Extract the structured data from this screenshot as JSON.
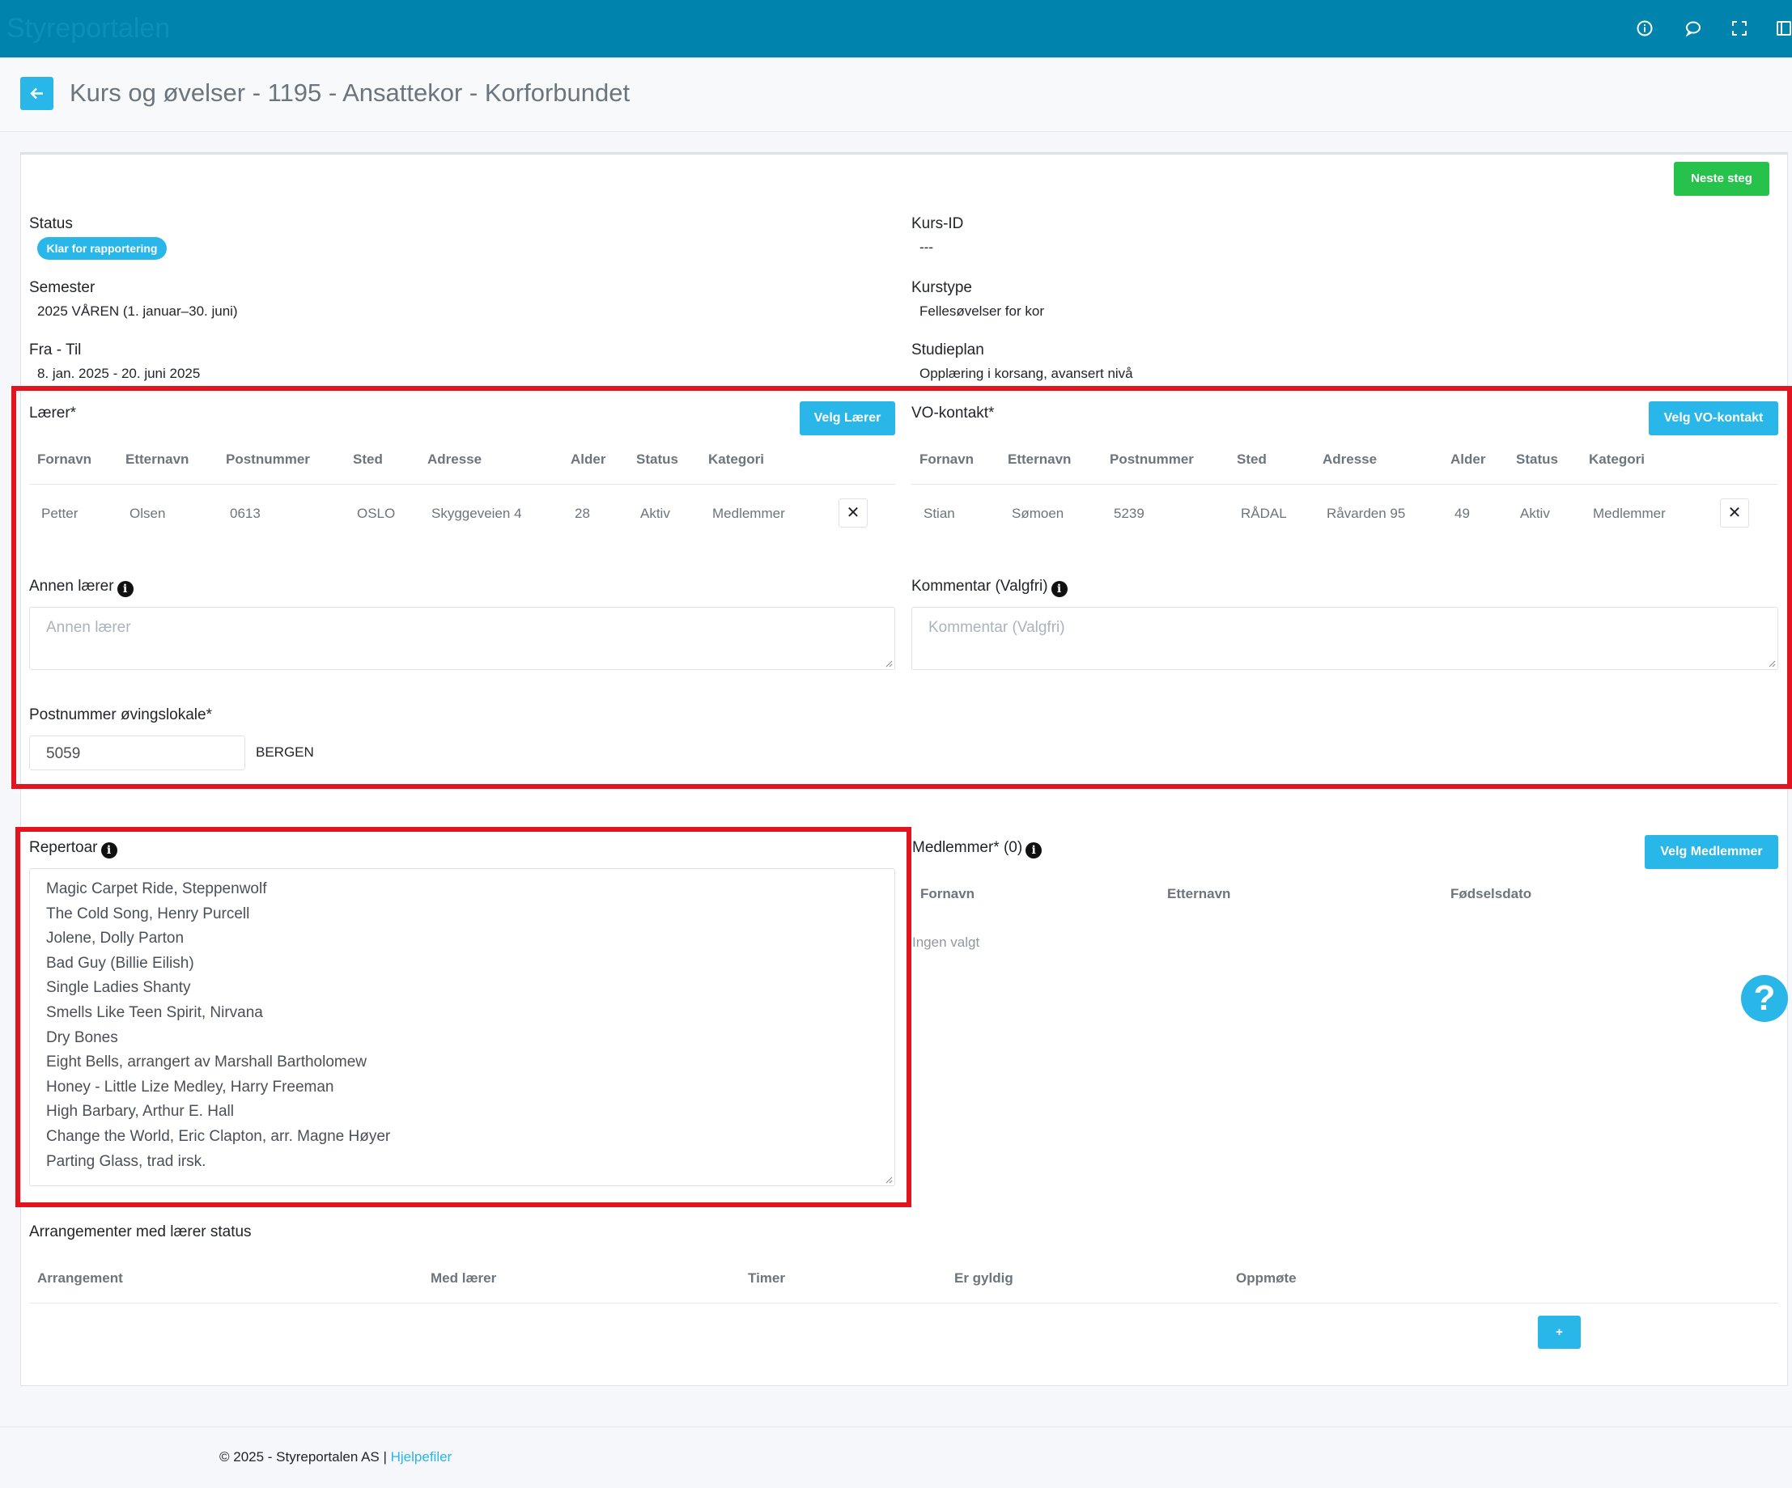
{
  "topbar": {
    "brand": "Styreportalen"
  },
  "header": {
    "title": "Kurs og øvelser - 1195 - Ansattekor - Korforbundet"
  },
  "actions": {
    "next_step": "Neste steg"
  },
  "info": {
    "status_label": "Status",
    "status_value": "Klar for rapportering",
    "kurs_id_label": "Kurs-ID",
    "kurs_id_value": "---",
    "semester_label": "Semester",
    "semester_value": "2025 VÅREN (1. januar–30. juni)",
    "kurstype_label": "Kurstype",
    "kurstype_value": "Fellesøvelser for kor",
    "fra_til_label": "Fra - Til",
    "fra_til_value": "8. jan. 2025 - 20. juni 2025",
    "studieplan_label": "Studieplan",
    "studieplan_value": "Opplæring i korsang, avansert nivå"
  },
  "teacher": {
    "label": "Lærer*",
    "button": "Velg Lærer",
    "columns": [
      "Fornavn",
      "Etternavn",
      "Postnummer",
      "Sted",
      "Adresse",
      "Alder",
      "Status",
      "Kategori"
    ],
    "row": [
      "Petter",
      "Olsen",
      "0613",
      "OSLO",
      "Skyggeveien 4",
      "28",
      "Aktiv",
      "Medlemmer"
    ]
  },
  "vo_contact": {
    "label": "VO-kontakt*",
    "button": "Velg VO-kontakt",
    "columns": [
      "Fornavn",
      "Etternavn",
      "Postnummer",
      "Sted",
      "Adresse",
      "Alder",
      "Status",
      "Kategori"
    ],
    "row": [
      "Stian",
      "Sømoen",
      "5239",
      "RÅDAL",
      "Råvarden 95",
      "49",
      "Aktiv",
      "Medlemmer"
    ]
  },
  "other_teacher": {
    "label": "Annen lærer",
    "placeholder": "Annen lærer"
  },
  "comment": {
    "label": "Kommentar (Valgfri)",
    "placeholder": "Kommentar (Valgfri)"
  },
  "postcode": {
    "label": "Postnummer øvingslokale*",
    "value": "5059",
    "city": "BERGEN"
  },
  "repertoire": {
    "label": "Repertoar",
    "lines": [
      "Magic Carpet Ride, Steppenwolf",
      "The Cold Song, Henry Purcell",
      "Jolene, Dolly Parton",
      "Bad Guy (Billie Eilish)",
      "Single Ladies Shanty",
      "Smells Like Teen Spirit, Nirvana",
      "Dry Bones",
      "Eight Bells, arrangert av Marshall Bartholomew",
      "Honey - Little Lize Medley, Harry Freeman",
      "High Barbary, Arthur E. Hall",
      "Change the World, Eric Clapton, arr. Magne Høyer",
      "Parting Glass, trad irsk."
    ]
  },
  "members": {
    "label": "Medlemmer* (0)",
    "button": "Velg Medlemmer",
    "columns": [
      "Fornavn",
      "Etternavn",
      "Fødselsdato"
    ],
    "empty": "Ingen valgt"
  },
  "arrangements": {
    "label": "Arrangementer med lærer status",
    "columns": [
      "Arrangement",
      "Med lærer",
      "Timer",
      "Er gyldig",
      "Oppmøte"
    ],
    "add_button": "+"
  },
  "footer": {
    "copyright": "© 2025 - Styreportalen AS |",
    "help_link": "Hjelpefiler"
  },
  "colors": {
    "topbar": "#0084ad",
    "primary": "#29b6e8",
    "success": "#27c24c",
    "highlight": "#e3141e"
  }
}
